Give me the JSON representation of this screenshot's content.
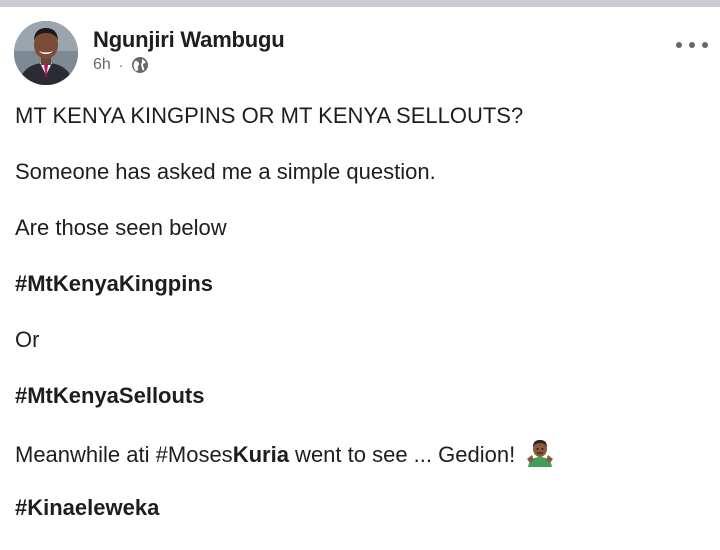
{
  "post": {
    "author": "Ngunjiri Wambugu",
    "time": "6h",
    "separator": "·",
    "privacy_icon": "globe-icon",
    "more_icon": "more-horizontal-icon",
    "lines": {
      "title": "MT KENYA KINGPINS OR MT KENYA SELLOUTS?",
      "question": "Someone has asked me a simple question.",
      "prompt": "Are those seen below",
      "hashtag1": "#MtKenyaKingpins",
      "or": "Or",
      "hashtag2": "#MtKenyaSellouts",
      "meanwhile_prefix": "Meanwhile ati ",
      "meanwhile_tag": "#Moses",
      "meanwhile_tag_bold": "Kuria",
      "meanwhile_suffix": " went to see ... Gedion!",
      "emoji": "person-shrugging-emoji",
      "hashtag3": "#Kinaeleweka"
    }
  },
  "colors": {
    "text": "#1c1e21",
    "secondary_text": "#65676b",
    "top_strip": "#c9ccd1"
  }
}
